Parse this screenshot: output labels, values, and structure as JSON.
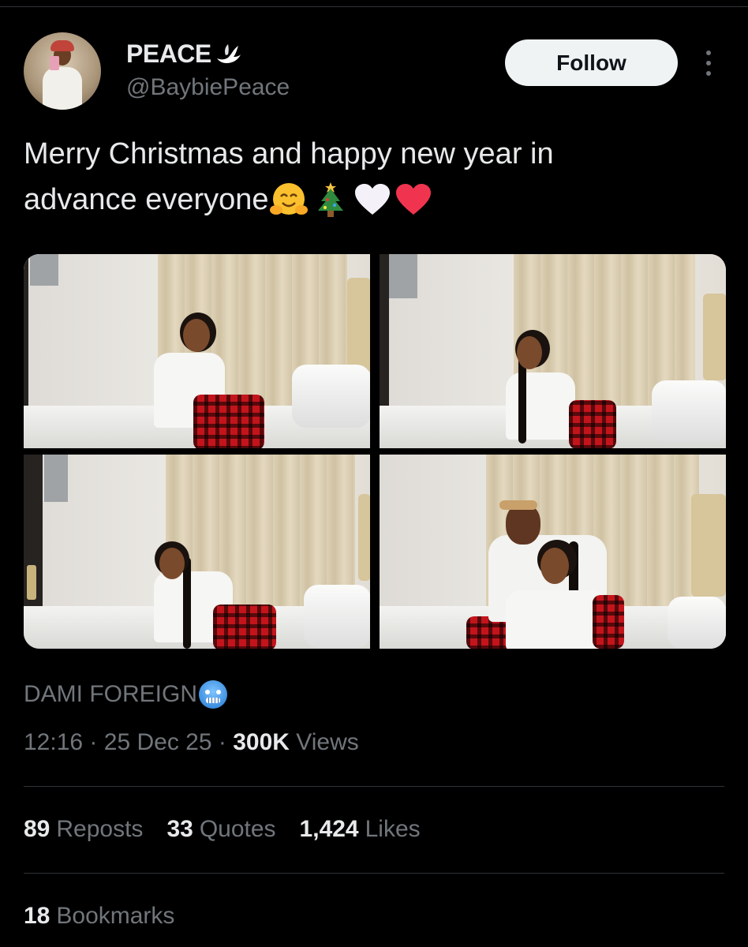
{
  "tweet": {
    "author": {
      "display_name": "PEACE",
      "name_emoji_icon": "dove-icon",
      "handle": "@BaybiePeace"
    },
    "follow_label": "Follow",
    "more_icon": "more-vertical-icon",
    "text_line1": "Merry Christmas and happy new year in",
    "text_line2": "advance everyone",
    "text_emojis": [
      "hugging-face",
      "christmas-tree",
      "white-heart",
      "red-heart"
    ],
    "media_count": 4,
    "caption": "DAMI FOREIGN",
    "caption_emoji_icon": "cold-face-icon",
    "time": "12:16",
    "date": "25 Dec 25",
    "views_count": "300K",
    "views_label": "Views",
    "separator": "·",
    "stats": {
      "reposts": {
        "count": "89",
        "label": "Reposts"
      },
      "quotes": {
        "count": "33",
        "label": "Quotes"
      },
      "likes": {
        "count": "1,424",
        "label": "Likes"
      },
      "bookmarks": {
        "count": "18",
        "label": "Bookmarks"
      }
    }
  },
  "colors": {
    "background": "#000000",
    "primary_text": "#e7e9ea",
    "secondary_text": "#71767b",
    "divider": "#2f3336",
    "follow_bg": "#eff3f4",
    "follow_text": "#0f1419"
  }
}
